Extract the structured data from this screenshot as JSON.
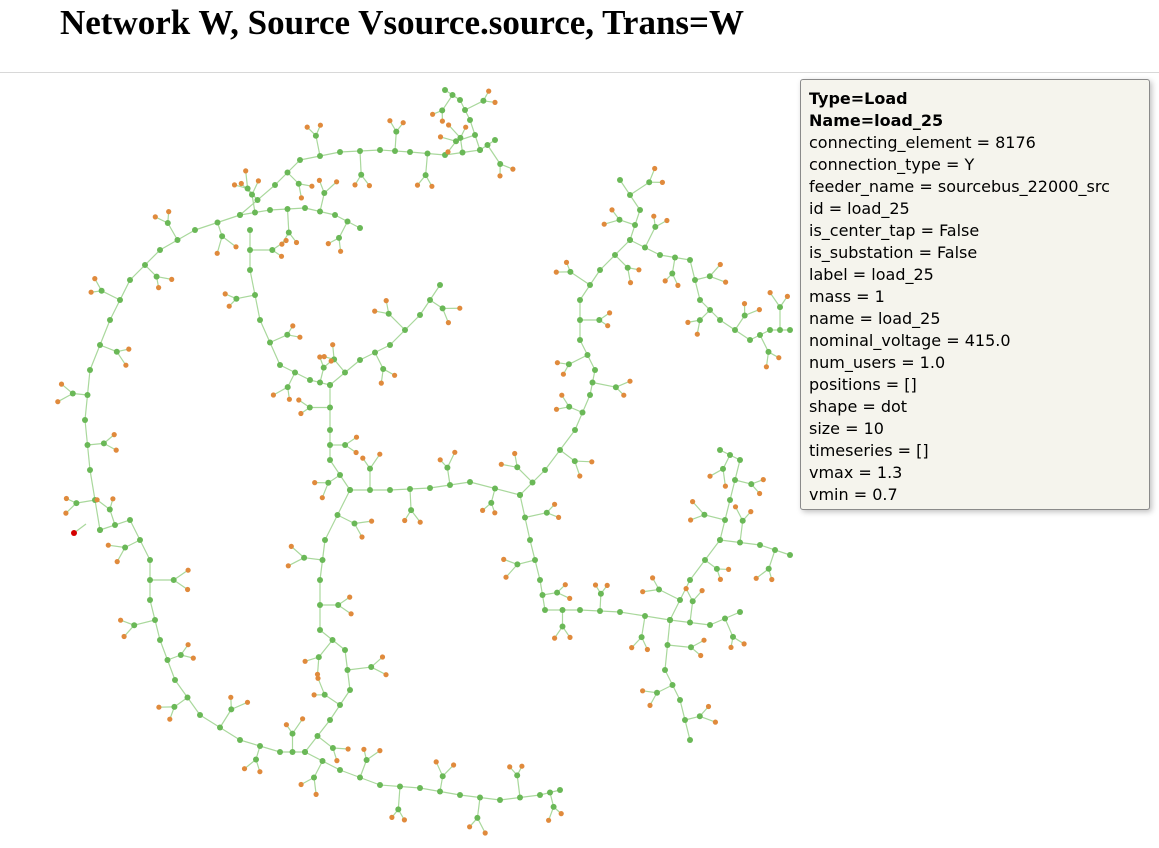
{
  "header": {
    "title": "Network W, Source Vsource.source, Trans=W"
  },
  "tooltip": {
    "type_line": "Type=Load",
    "name_line": "Name=load_25",
    "attributes": [
      "connecting_element = 8176",
      "connection_type = Y",
      "feeder_name = sourcebus_22000_src",
      "id = load_25",
      "is_center_tap = False",
      "is_substation = False",
      "label = load_25",
      "mass = 1",
      "name = load_25",
      "nominal_voltage = 415.0",
      "num_users = 1.0",
      "positions = []",
      "shape = dot",
      "size = 10",
      "timeseries = []",
      "vmax = 1.3",
      "vmin = 0.7"
    ]
  },
  "colors": {
    "bus_node": "#6ab857",
    "load_node": "#e08a3c",
    "selected_node": "#d40000",
    "edge": "#a9d89c"
  }
}
